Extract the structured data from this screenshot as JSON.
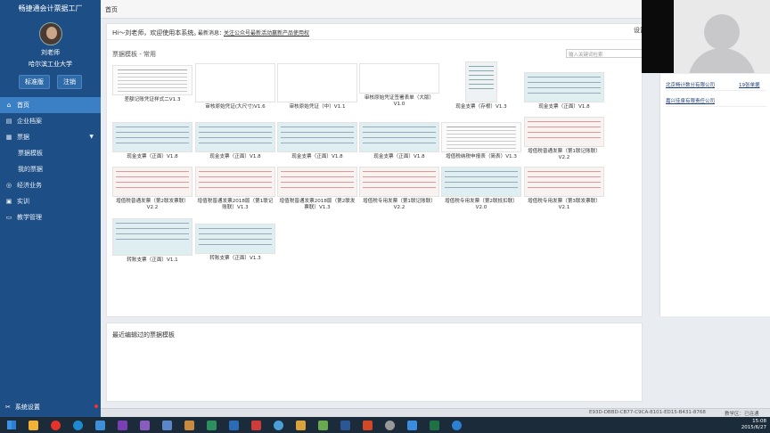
{
  "app": {
    "title": "畅捷通会计票据工厂"
  },
  "user": {
    "name": "刘老师",
    "school": "哈尔滨工业大学",
    "edition_btn": "标准版",
    "logout_btn": "注销"
  },
  "nav": {
    "items": [
      {
        "label": "首页",
        "icon": "home-icon"
      },
      {
        "label": "企业档案",
        "icon": "folder-icon"
      },
      {
        "label": "票据",
        "icon": "ticket-icon"
      },
      {
        "label": "票据模板"
      },
      {
        "label": "我的票据"
      },
      {
        "label": "经济业务",
        "icon": "business-icon"
      },
      {
        "label": "实训",
        "icon": "training-icon"
      },
      {
        "label": "教学管理",
        "icon": "monitor-icon"
      }
    ],
    "settings": "系统设置"
  },
  "header": {
    "breadcrumb": "首页"
  },
  "main": {
    "greeting": "Hi～刘老师，欢迎使用本系统。",
    "notice_label": "最新消息：",
    "notice_text": "关注公众号最新活动赢新产品使用权",
    "section_title": "票据模板 - 常用",
    "search_placeholder": "输入关键词检索",
    "templates": [
      "差额记账凭证样式二V1.3",
      "审核原始凭证(大尺寸)V1.6",
      "审核原始凭证（中）V1.1",
      "审核原始凭证签署表单（大版）V1.0",
      "现金支票（存根）V1.3",
      "现金支票（正面）V1.8",
      "现金支票（正面）V1.8",
      "现金支票（正面）V1.8",
      "现金支票（正面）V1.8",
      "现金支票（正面）V1.8",
      "增值税纳税申报表（简表）V1.3",
      "增值税普通发票（第1联记账联）V2.2",
      "增值税普通发票（第2联发票联）V2.2",
      "增值税普通发票2018版（第1联记账联）V1.3",
      "增值税普通发票2018版（第2联发票联）V1.3",
      "增值税专用发票（第1联记账联）V2.2",
      "增值税专用发票（第2联抵扣联）V2.0",
      "增值税专用发票（第3联发票联）V2.1",
      "转账支票（正面）V1.1",
      "转账支票（正面）V1.3"
    ]
  },
  "recent": {
    "title": "最近编辑过的票据模板"
  },
  "right_panel": {
    "settings_label": "设置",
    "company_1": "北京畅计数分有限公司",
    "company_1_count": "19张单据",
    "company_2": "嘉兴佳泉有限责任公司"
  },
  "statusbar": {
    "session_id": "E93D-DBBD-CB77-C9CA-8101-ED15-B431-8768",
    "status": "教学区：已连通"
  },
  "taskbar": {
    "time": "15:08",
    "date": "2015/6/27"
  }
}
